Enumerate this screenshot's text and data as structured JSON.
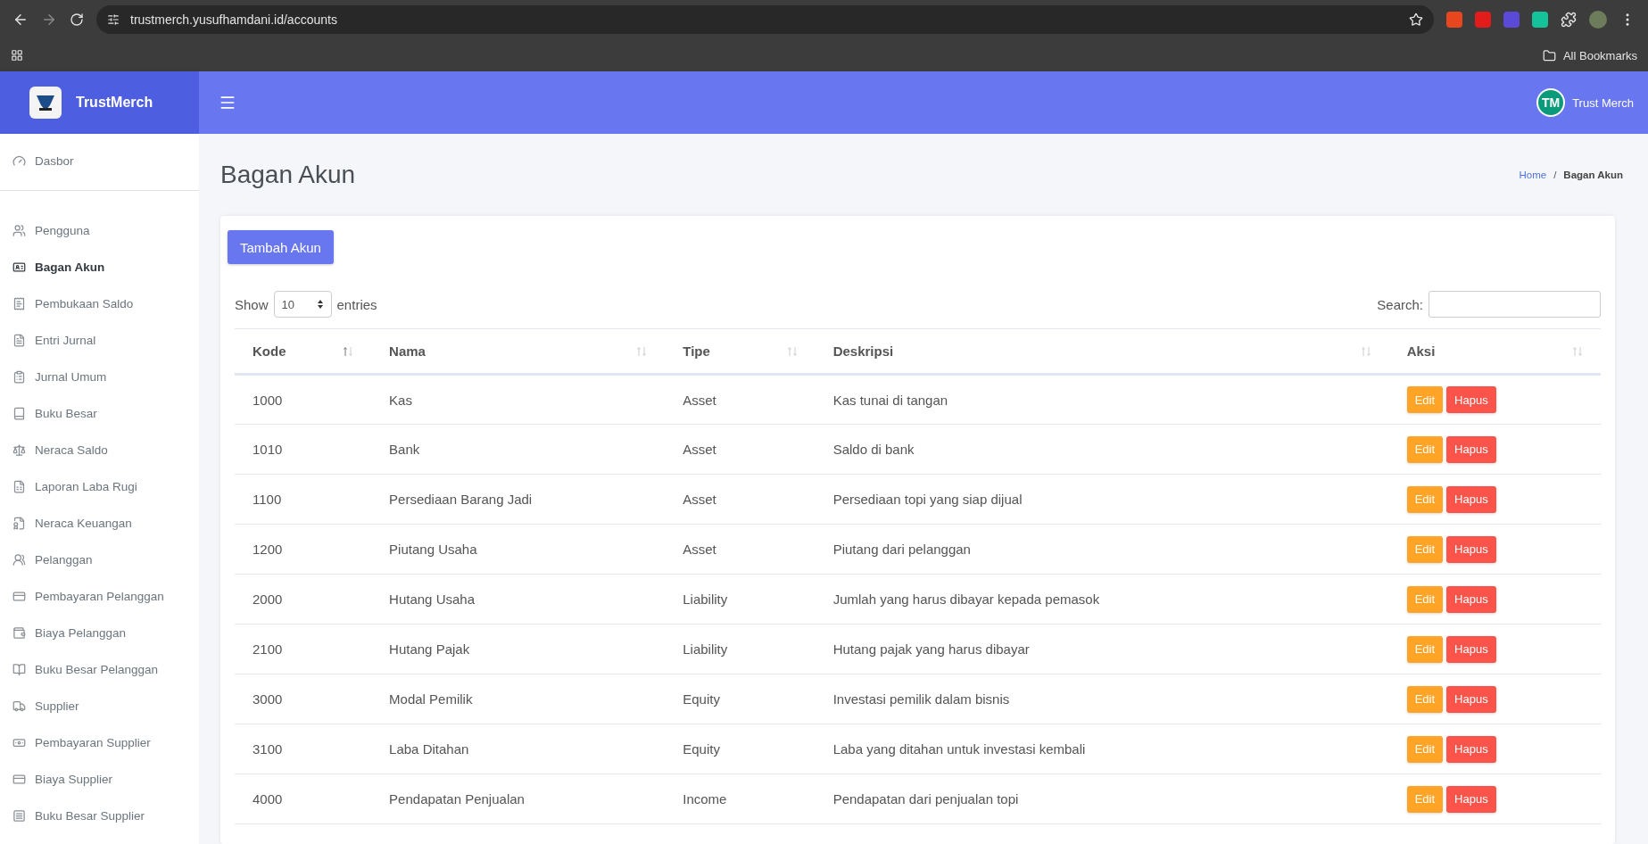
{
  "browser": {
    "url": "trustmerch.yusufhamdani.id/accounts",
    "bookmarks_label": "All Bookmarks"
  },
  "brand": {
    "name": "TrustMerch"
  },
  "sidebar": {
    "top_items": [
      {
        "label": "Dasbor",
        "selected": false
      }
    ],
    "items": [
      {
        "label": "Pengguna",
        "selected": false
      },
      {
        "label": "Bagan Akun",
        "selected": true
      },
      {
        "label": "Pembukaan Saldo",
        "selected": false
      },
      {
        "label": "Entri Jurnal",
        "selected": false
      },
      {
        "label": "Jurnal Umum",
        "selected": false
      },
      {
        "label": "Buku Besar",
        "selected": false
      },
      {
        "label": "Neraca Saldo",
        "selected": false
      },
      {
        "label": "Laporan Laba Rugi",
        "selected": false
      },
      {
        "label": "Neraca Keuangan",
        "selected": false
      },
      {
        "label": "Pelanggan",
        "selected": false
      },
      {
        "label": "Pembayaran Pelanggan",
        "selected": false
      },
      {
        "label": "Biaya Pelanggan",
        "selected": false
      },
      {
        "label": "Buku Besar Pelanggan",
        "selected": false
      },
      {
        "label": "Supplier",
        "selected": false
      },
      {
        "label": "Pembayaran Supplier",
        "selected": false
      },
      {
        "label": "Biaya Supplier",
        "selected": false
      },
      {
        "label": "Buku Besar Supplier",
        "selected": false
      }
    ]
  },
  "user": {
    "initials": "TM",
    "name": "Trust Merch"
  },
  "page": {
    "title": "Bagan Akun",
    "breadcrumb": [
      "Home",
      "Bagan Akun"
    ],
    "breadcrumb_separator": "/"
  },
  "toolbar": {
    "add_button": "Tambah Akun",
    "show_label": "Show",
    "page_size": "10",
    "entries_label": "entries",
    "search_label": "Search:"
  },
  "table": {
    "columns": [
      {
        "label": "Kode",
        "sorted": true
      },
      {
        "label": "Nama",
        "sorted": false
      },
      {
        "label": "Tipe",
        "sorted": false
      },
      {
        "label": "Deskripsi",
        "sorted": false
      },
      {
        "label": "Aksi",
        "sorted": false
      }
    ],
    "rows": [
      {
        "cells": [
          "1000",
          "Kas",
          "Asset",
          "Kas tunai di tangan"
        ],
        "edit": "Edit",
        "delete": "Hapus"
      },
      {
        "cells": [
          "1010",
          "Bank",
          "Asset",
          "Saldo di bank"
        ],
        "edit": "Edit",
        "delete": "Hapus"
      },
      {
        "cells": [
          "1100",
          "Persediaan Barang Jadi",
          "Asset",
          "Persediaan topi yang siap dijual"
        ],
        "edit": "Edit",
        "delete": "Hapus"
      },
      {
        "cells": [
          "1200",
          "Piutang Usaha",
          "Asset",
          "Piutang dari pelanggan"
        ],
        "edit": "Edit",
        "delete": "Hapus"
      },
      {
        "cells": [
          "2000",
          "Hutang Usaha",
          "Liability",
          "Jumlah yang harus dibayar kepada pemasok"
        ],
        "edit": "Edit",
        "delete": "Hapus"
      },
      {
        "cells": [
          "2100",
          "Hutang Pajak",
          "Liability",
          "Hutang pajak yang harus dibayar"
        ],
        "edit": "Edit",
        "delete": "Hapus"
      },
      {
        "cells": [
          "3000",
          "Modal Pemilik",
          "Equity",
          "Investasi pemilik dalam bisnis"
        ],
        "edit": "Edit",
        "delete": "Hapus"
      },
      {
        "cells": [
          "3100",
          "Laba Ditahan",
          "Equity",
          "Laba yang ditahan untuk investasi kembali"
        ],
        "edit": "Edit",
        "delete": "Hapus"
      },
      {
        "cells": [
          "4000",
          "Pendapatan Penjualan",
          "Income",
          "Pendapatan dari penjualan topi"
        ],
        "edit": "Edit",
        "delete": "Hapus"
      }
    ]
  }
}
